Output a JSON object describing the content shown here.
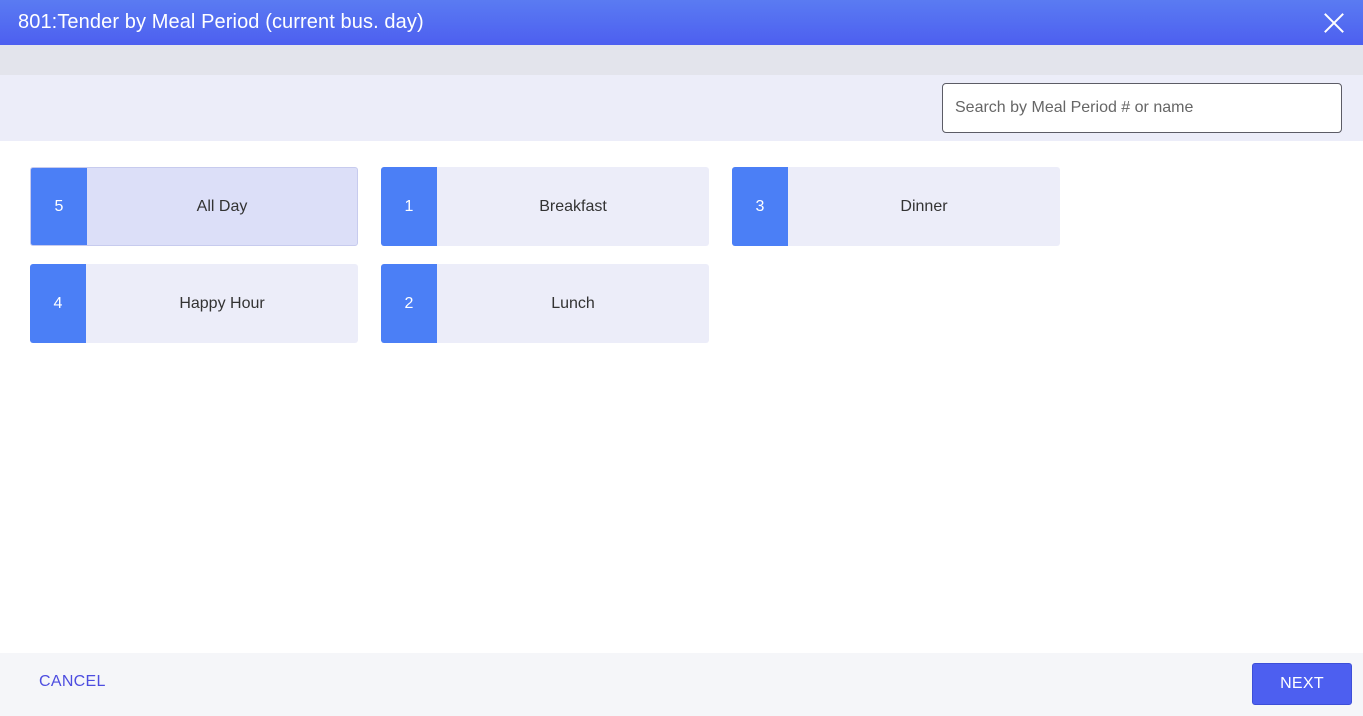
{
  "dialog": {
    "title": "801:Tender by Meal Period (current bus. day)"
  },
  "search": {
    "placeholder": "Search by Meal Period # or name",
    "value": ""
  },
  "meal_periods": [
    {
      "number": "5",
      "name": "All Day",
      "selected": true
    },
    {
      "number": "1",
      "name": "Breakfast",
      "selected": false
    },
    {
      "number": "3",
      "name": "Dinner",
      "selected": false
    },
    {
      "number": "4",
      "name": "Happy Hour",
      "selected": false
    },
    {
      "number": "2",
      "name": "Lunch",
      "selected": false
    }
  ],
  "footer": {
    "cancel_label": "CANCEL",
    "next_label": "NEXT"
  },
  "icons": {
    "close": "close-icon"
  },
  "colors": {
    "accent": "#4d5ff0",
    "number_tile": "#4b7ff6",
    "card_bg": "#ecedf9",
    "card_selected_bg": "#dcdff8"
  }
}
